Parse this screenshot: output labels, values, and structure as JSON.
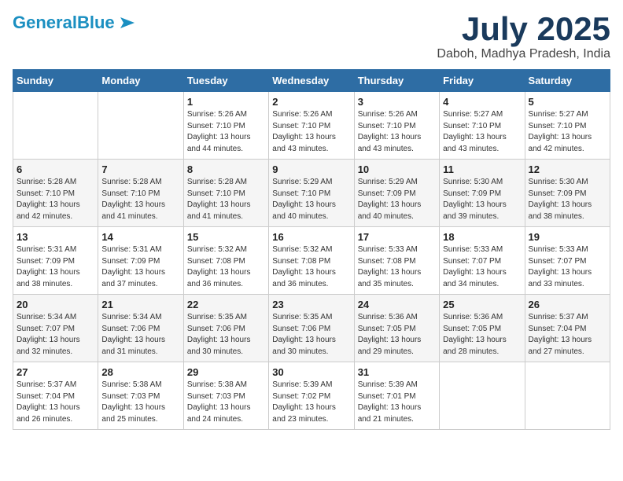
{
  "header": {
    "logo_line1": "General",
    "logo_line2": "Blue",
    "month": "July 2025",
    "location": "Daboh, Madhya Pradesh, India"
  },
  "weekdays": [
    "Sunday",
    "Monday",
    "Tuesday",
    "Wednesday",
    "Thursday",
    "Friday",
    "Saturday"
  ],
  "weeks": [
    [
      {
        "day": "",
        "info": ""
      },
      {
        "day": "",
        "info": ""
      },
      {
        "day": "1",
        "info": "Sunrise: 5:26 AM\nSunset: 7:10 PM\nDaylight: 13 hours\nand 44 minutes."
      },
      {
        "day": "2",
        "info": "Sunrise: 5:26 AM\nSunset: 7:10 PM\nDaylight: 13 hours\nand 43 minutes."
      },
      {
        "day": "3",
        "info": "Sunrise: 5:26 AM\nSunset: 7:10 PM\nDaylight: 13 hours\nand 43 minutes."
      },
      {
        "day": "4",
        "info": "Sunrise: 5:27 AM\nSunset: 7:10 PM\nDaylight: 13 hours\nand 43 minutes."
      },
      {
        "day": "5",
        "info": "Sunrise: 5:27 AM\nSunset: 7:10 PM\nDaylight: 13 hours\nand 42 minutes."
      }
    ],
    [
      {
        "day": "6",
        "info": "Sunrise: 5:28 AM\nSunset: 7:10 PM\nDaylight: 13 hours\nand 42 minutes."
      },
      {
        "day": "7",
        "info": "Sunrise: 5:28 AM\nSunset: 7:10 PM\nDaylight: 13 hours\nand 41 minutes."
      },
      {
        "day": "8",
        "info": "Sunrise: 5:28 AM\nSunset: 7:10 PM\nDaylight: 13 hours\nand 41 minutes."
      },
      {
        "day": "9",
        "info": "Sunrise: 5:29 AM\nSunset: 7:10 PM\nDaylight: 13 hours\nand 40 minutes."
      },
      {
        "day": "10",
        "info": "Sunrise: 5:29 AM\nSunset: 7:09 PM\nDaylight: 13 hours\nand 40 minutes."
      },
      {
        "day": "11",
        "info": "Sunrise: 5:30 AM\nSunset: 7:09 PM\nDaylight: 13 hours\nand 39 minutes."
      },
      {
        "day": "12",
        "info": "Sunrise: 5:30 AM\nSunset: 7:09 PM\nDaylight: 13 hours\nand 38 minutes."
      }
    ],
    [
      {
        "day": "13",
        "info": "Sunrise: 5:31 AM\nSunset: 7:09 PM\nDaylight: 13 hours\nand 38 minutes."
      },
      {
        "day": "14",
        "info": "Sunrise: 5:31 AM\nSunset: 7:09 PM\nDaylight: 13 hours\nand 37 minutes."
      },
      {
        "day": "15",
        "info": "Sunrise: 5:32 AM\nSunset: 7:08 PM\nDaylight: 13 hours\nand 36 minutes."
      },
      {
        "day": "16",
        "info": "Sunrise: 5:32 AM\nSunset: 7:08 PM\nDaylight: 13 hours\nand 36 minutes."
      },
      {
        "day": "17",
        "info": "Sunrise: 5:33 AM\nSunset: 7:08 PM\nDaylight: 13 hours\nand 35 minutes."
      },
      {
        "day": "18",
        "info": "Sunrise: 5:33 AM\nSunset: 7:07 PM\nDaylight: 13 hours\nand 34 minutes."
      },
      {
        "day": "19",
        "info": "Sunrise: 5:33 AM\nSunset: 7:07 PM\nDaylight: 13 hours\nand 33 minutes."
      }
    ],
    [
      {
        "day": "20",
        "info": "Sunrise: 5:34 AM\nSunset: 7:07 PM\nDaylight: 13 hours\nand 32 minutes."
      },
      {
        "day": "21",
        "info": "Sunrise: 5:34 AM\nSunset: 7:06 PM\nDaylight: 13 hours\nand 31 minutes."
      },
      {
        "day": "22",
        "info": "Sunrise: 5:35 AM\nSunset: 7:06 PM\nDaylight: 13 hours\nand 30 minutes."
      },
      {
        "day": "23",
        "info": "Sunrise: 5:35 AM\nSunset: 7:06 PM\nDaylight: 13 hours\nand 30 minutes."
      },
      {
        "day": "24",
        "info": "Sunrise: 5:36 AM\nSunset: 7:05 PM\nDaylight: 13 hours\nand 29 minutes."
      },
      {
        "day": "25",
        "info": "Sunrise: 5:36 AM\nSunset: 7:05 PM\nDaylight: 13 hours\nand 28 minutes."
      },
      {
        "day": "26",
        "info": "Sunrise: 5:37 AM\nSunset: 7:04 PM\nDaylight: 13 hours\nand 27 minutes."
      }
    ],
    [
      {
        "day": "27",
        "info": "Sunrise: 5:37 AM\nSunset: 7:04 PM\nDaylight: 13 hours\nand 26 minutes."
      },
      {
        "day": "28",
        "info": "Sunrise: 5:38 AM\nSunset: 7:03 PM\nDaylight: 13 hours\nand 25 minutes."
      },
      {
        "day": "29",
        "info": "Sunrise: 5:38 AM\nSunset: 7:03 PM\nDaylight: 13 hours\nand 24 minutes."
      },
      {
        "day": "30",
        "info": "Sunrise: 5:39 AM\nSunset: 7:02 PM\nDaylight: 13 hours\nand 23 minutes."
      },
      {
        "day": "31",
        "info": "Sunrise: 5:39 AM\nSunset: 7:01 PM\nDaylight: 13 hours\nand 21 minutes."
      },
      {
        "day": "",
        "info": ""
      },
      {
        "day": "",
        "info": ""
      }
    ]
  ]
}
